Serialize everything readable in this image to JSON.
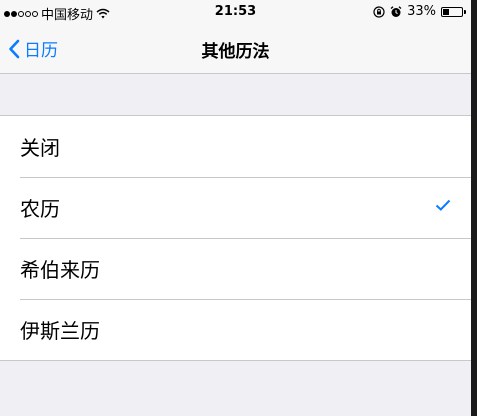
{
  "status_bar": {
    "carrier": "中国移动",
    "time": "21:53",
    "battery_text": "33%",
    "battery_level": 0.33
  },
  "nav": {
    "back_label": "日历",
    "title": "其他历法"
  },
  "options": [
    {
      "label": "关闭",
      "selected": false
    },
    {
      "label": "农历",
      "selected": true
    },
    {
      "label": "希伯来历",
      "selected": false
    },
    {
      "label": "伊斯兰历",
      "selected": false
    }
  ],
  "colors": {
    "accent": "#0a7cff",
    "background": "#efeff4",
    "separator": "#c8c7cc"
  },
  "icons": {
    "back": "chevron-left-icon",
    "check": "checkmark-icon",
    "wifi": "wifi-icon",
    "lock": "orientation-lock-icon",
    "alarm": "alarm-icon",
    "battery": "battery-icon"
  }
}
